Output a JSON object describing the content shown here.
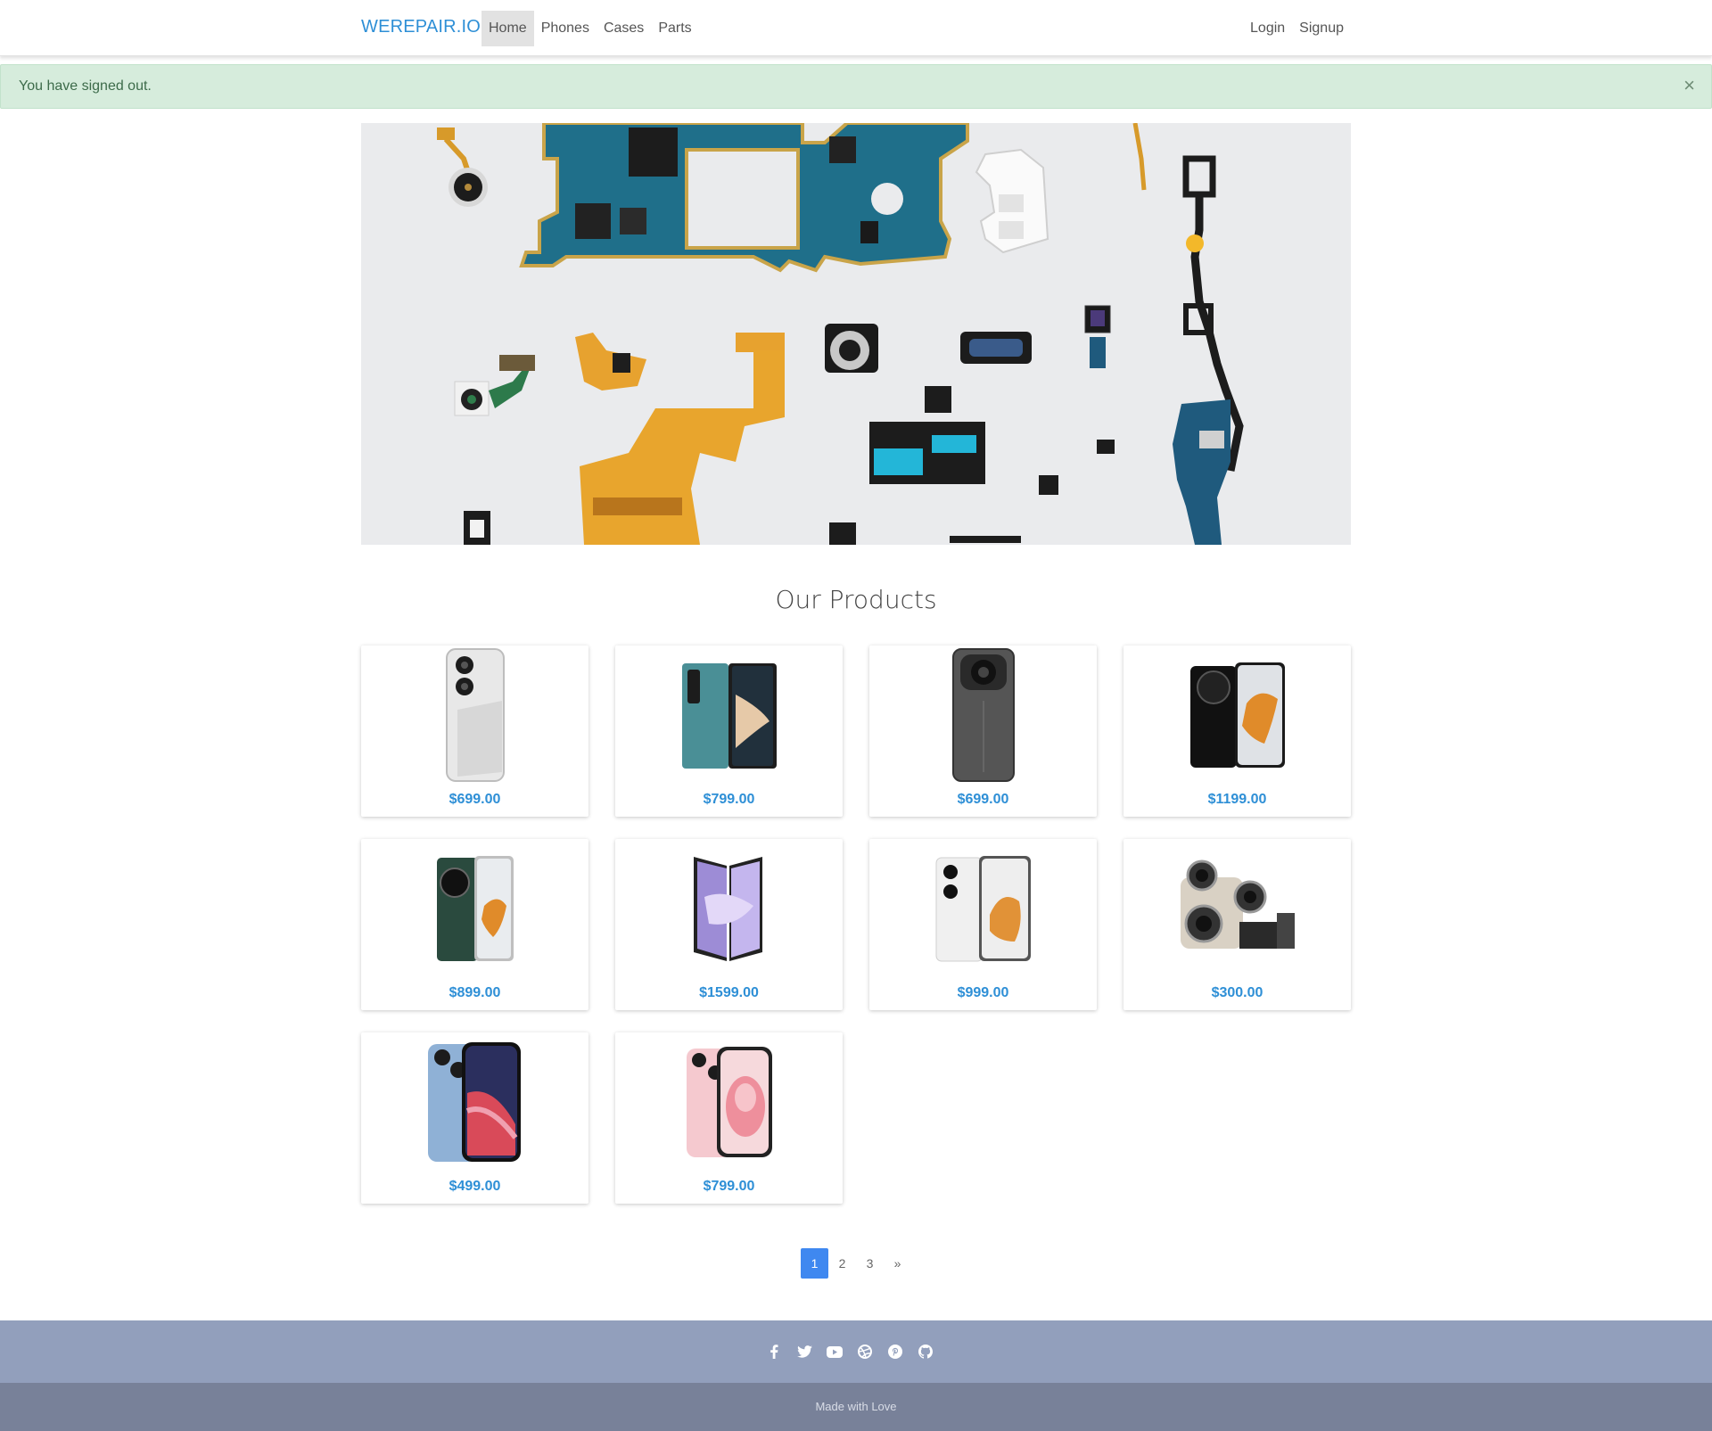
{
  "navbar": {
    "brand": "WEREPAIR.IO",
    "links": [
      "Home",
      "Phones",
      "Cases",
      "Parts"
    ],
    "active": "Home",
    "right_links": [
      "Login",
      "Signup"
    ]
  },
  "alert": {
    "message": "You have signed out.",
    "close": "×"
  },
  "hero": {
    "image": "phone-parts-flatlay"
  },
  "products": {
    "title": "Our Products",
    "items": [
      {
        "price": "$699.00",
        "image": "white-phone-dual-camera"
      },
      {
        "price": "$799.00",
        "image": "teal-foldable-phone"
      },
      {
        "price": "$699.00",
        "image": "grey-phone-octagon-camera"
      },
      {
        "price": "$1199.00",
        "image": "black-phone-round-camera"
      },
      {
        "price": "$899.00",
        "image": "green-foldable-phone"
      },
      {
        "price": "$1599.00",
        "image": "purple-foldable-phone"
      },
      {
        "price": "$999.00",
        "image": "white-phone-orange-wallpaper"
      },
      {
        "price": "$300.00",
        "image": "camera-module-part"
      },
      {
        "price": "$499.00",
        "image": "blue-iphone"
      },
      {
        "price": "$799.00",
        "image": "pink-iphone"
      }
    ]
  },
  "pagination": {
    "pages": [
      "1",
      "2",
      "3"
    ],
    "next": "»",
    "active": "1"
  },
  "footer": {
    "social_icons": [
      "facebook-icon",
      "twitter-icon",
      "youtube-icon",
      "dribbble-icon",
      "pinterest-icon",
      "github-icon"
    ],
    "text": "Made with Love"
  },
  "colors": {
    "brand": "#2e8fd6",
    "alert_bg": "#d6ecdc",
    "footer_top": "#929fbc",
    "footer_bottom": "#788199",
    "page_active": "#3f88f0"
  }
}
